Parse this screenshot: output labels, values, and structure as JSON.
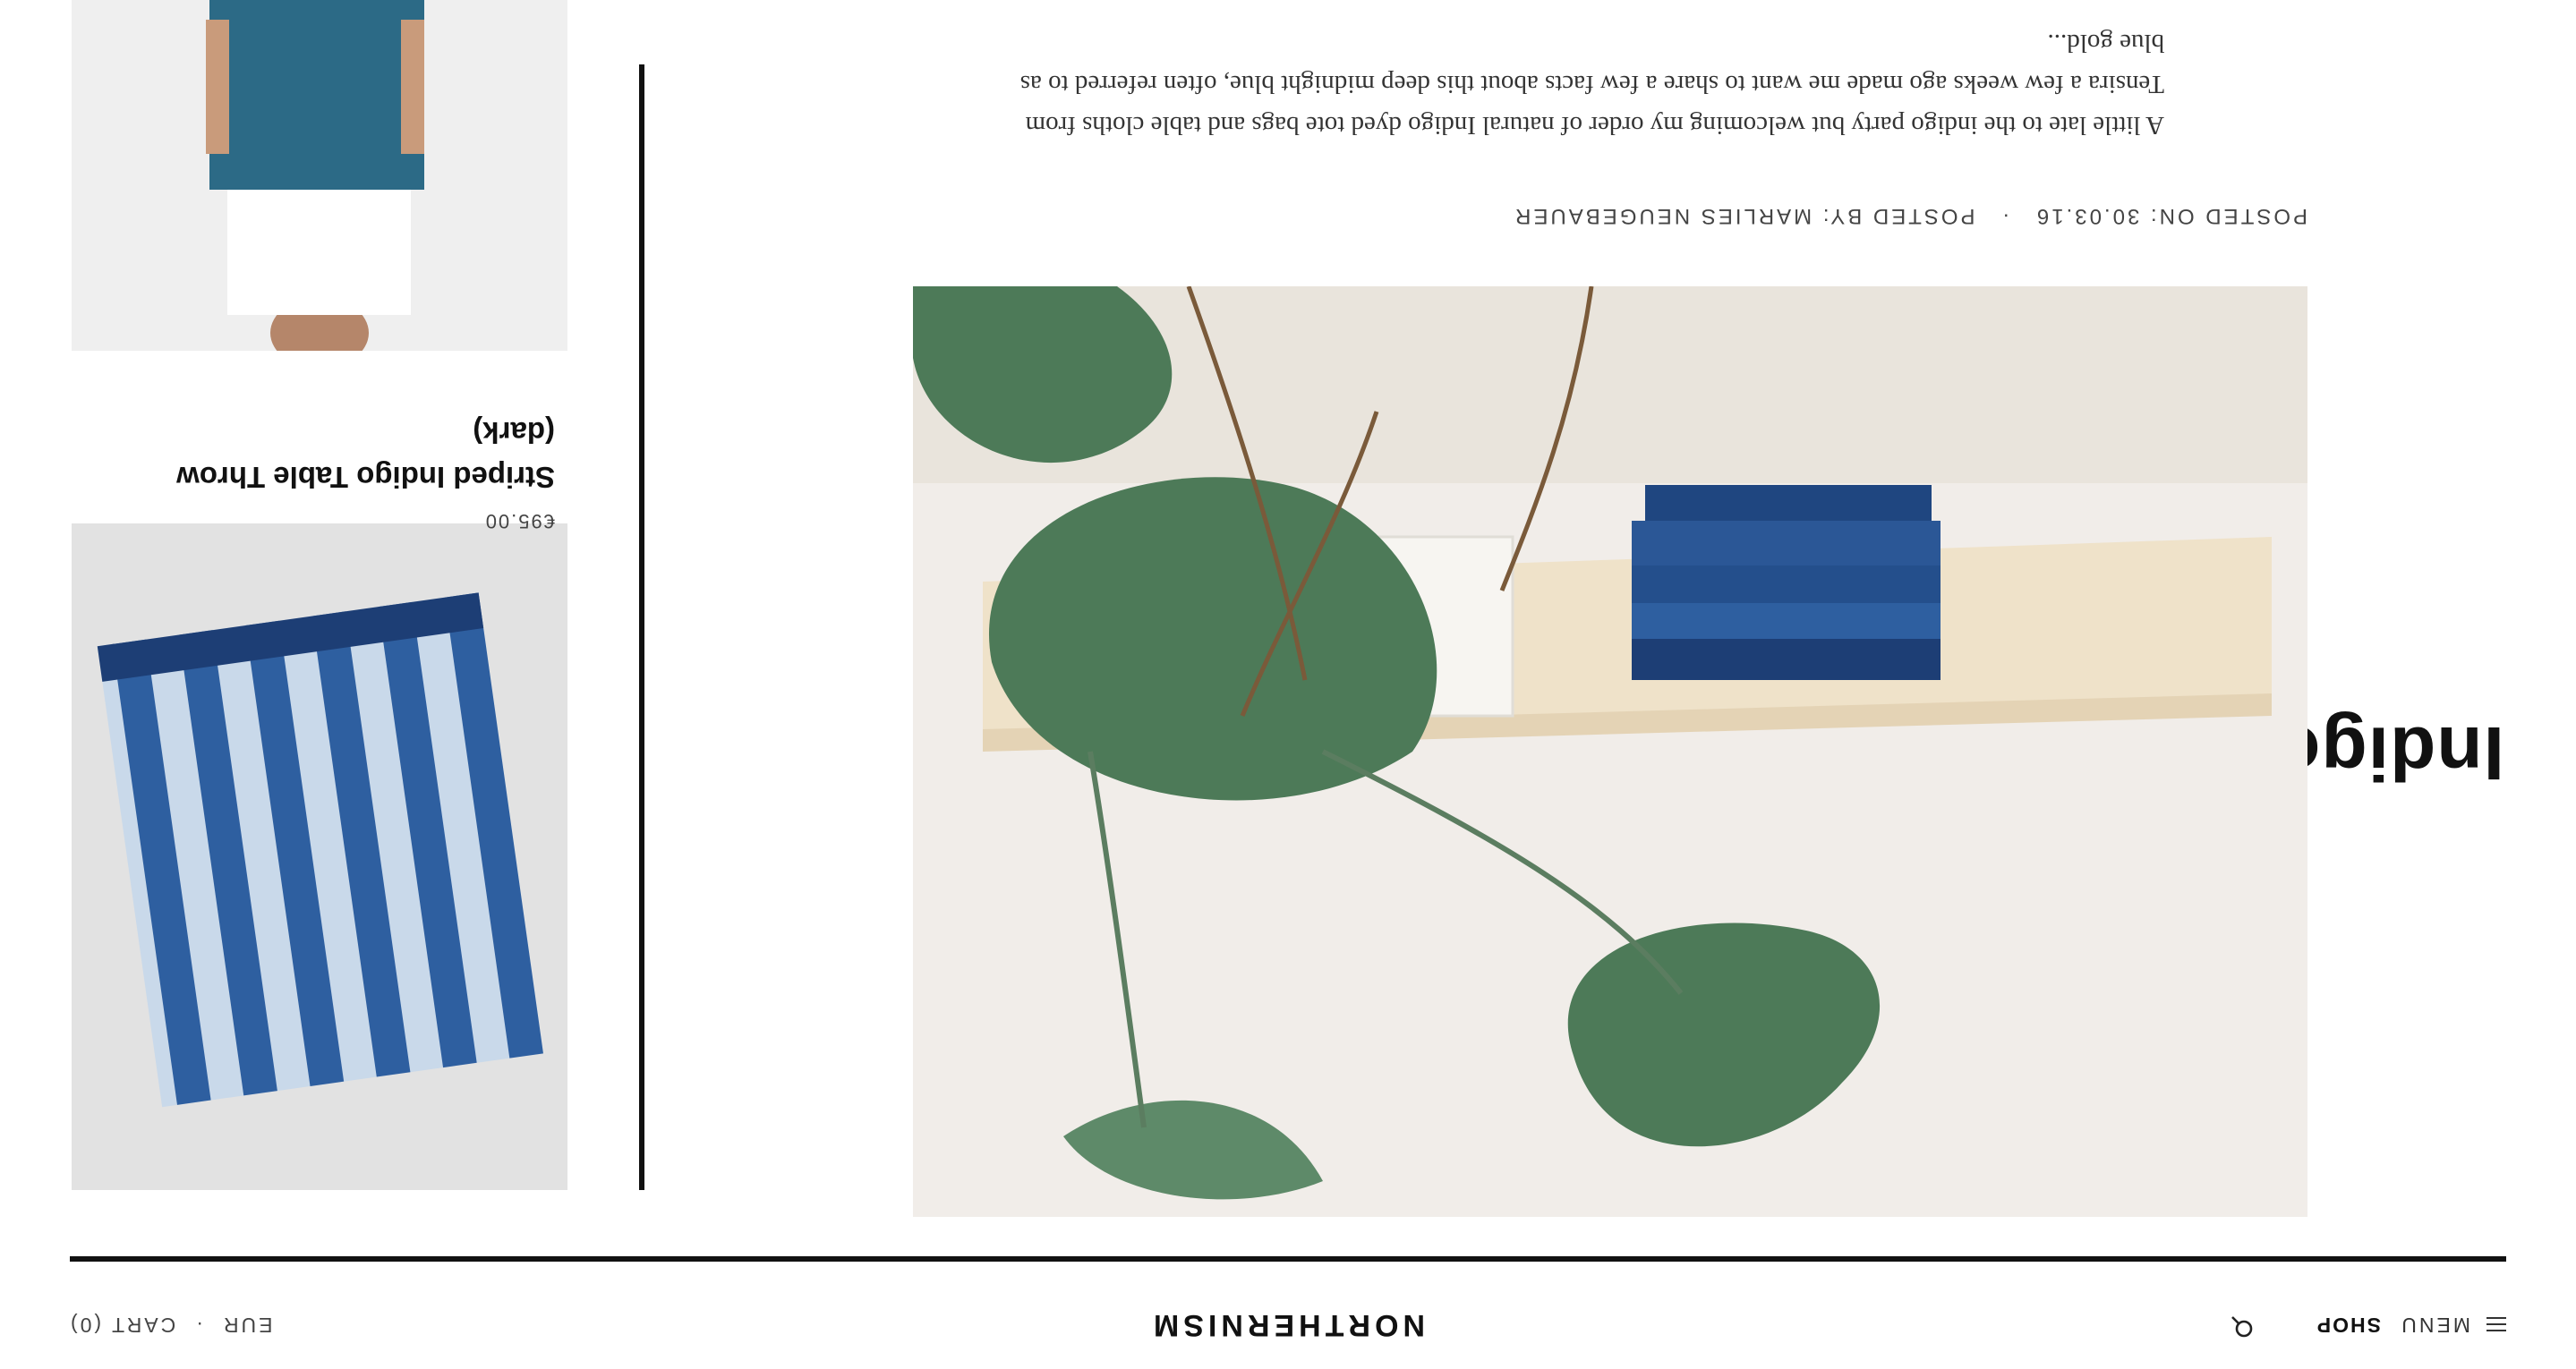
{
  "header": {
    "menu_label": "MENU",
    "shop_label": "SHOP",
    "brand": "NORTHERNISM",
    "currency": "EUR",
    "separator": "·",
    "cart_label": "CART (0)"
  },
  "post": {
    "title": "Indigo",
    "meta_posted_on": "POSTED ON: 30.03.16",
    "meta_separator": "·",
    "meta_posted_by": "POSTED BY: MARLIES NEUGEBAUER",
    "excerpt": "A little late to the indigo party but welcoming my order of natural Indigo dyed tote bags and table cloths from Tensira a few weeks ago made me want to share a few facts about this deep midnight blue, often referred to as blue gold..."
  },
  "sidebar": {
    "product": {
      "price": "€95.00",
      "name": "Striped Indigo Table Throw (dark)"
    }
  },
  "colors": {
    "indigo": "#2e5fa0",
    "indigo_dark": "#1d3e75",
    "leaf": "#4d7a58",
    "divider": "#111111"
  }
}
